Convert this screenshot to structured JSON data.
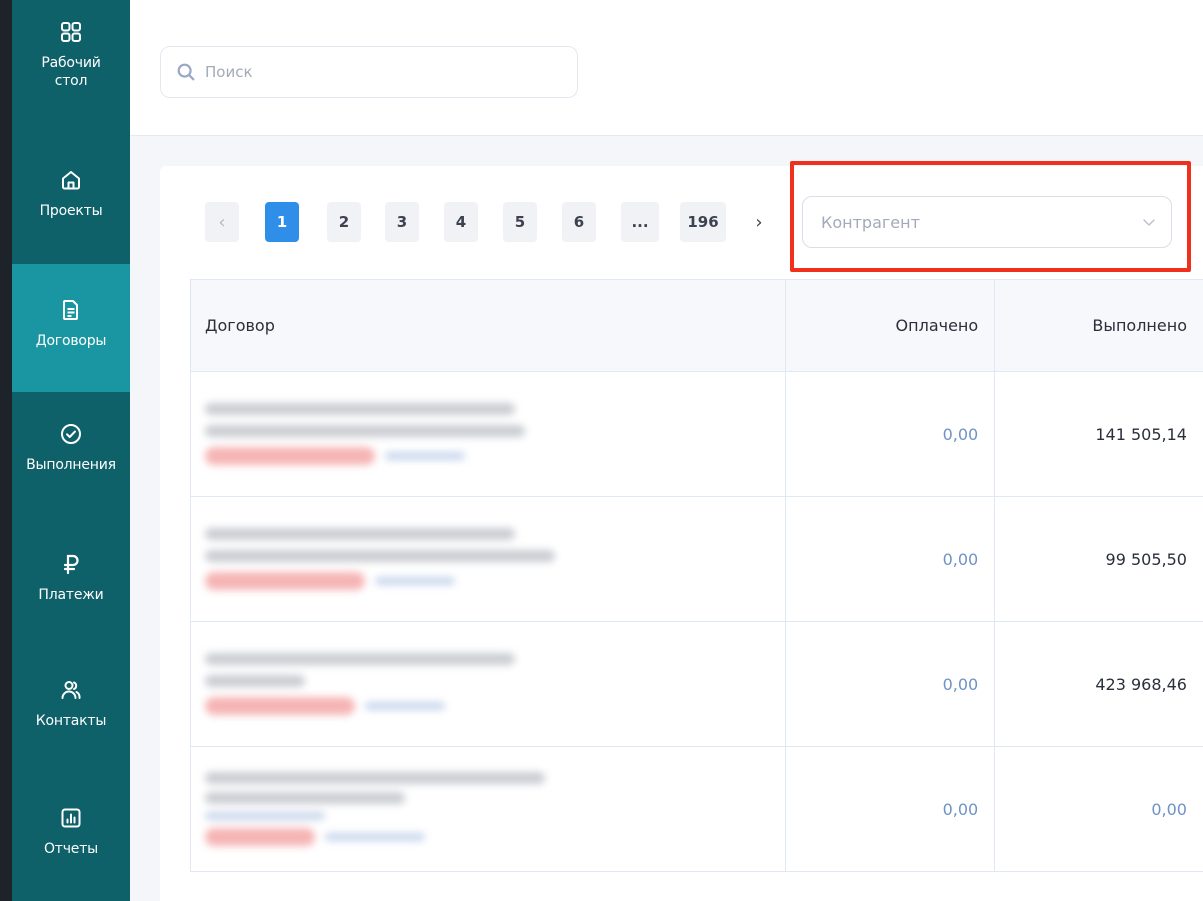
{
  "sidebar": {
    "items": [
      {
        "label": "Рабочий\nстол",
        "icon": "dashboard-grid-icon",
        "active": false
      },
      {
        "label": "Проекты",
        "icon": "home-icon",
        "active": false
      },
      {
        "label": "Договоры",
        "icon": "document-icon",
        "active": true
      },
      {
        "label": "Выполнения",
        "icon": "check-circle-icon",
        "active": false
      },
      {
        "label": "Платежи",
        "icon": "ruble-icon",
        "active": false
      },
      {
        "label": "Контакты",
        "icon": "users-icon",
        "active": false
      },
      {
        "label": "Отчеты",
        "icon": "bar-chart-icon",
        "active": false
      }
    ]
  },
  "search": {
    "placeholder": "Поиск"
  },
  "pagination": {
    "prev": "‹",
    "pages": [
      "1",
      "2",
      "3",
      "4",
      "5",
      "6",
      "...",
      "196"
    ],
    "current": "1",
    "next": "›"
  },
  "filter": {
    "placeholder": "Контрагент"
  },
  "table": {
    "columns": [
      "Договор",
      "Оплачено",
      "Выполнено"
    ],
    "rows": [
      {
        "paid": "0,00",
        "done": "141 505,14"
      },
      {
        "paid": "0,00",
        "done": "99 505,50"
      },
      {
        "paid": "0,00",
        "done": "423 968,46"
      },
      {
        "paid": "0,00",
        "done": "0,00"
      }
    ]
  },
  "colors": {
    "sidebar": "#0e6069",
    "sidebar_active": "#1a96a2",
    "accent": "#2f8fe8",
    "highlight": "#f0301d",
    "muted_value": "#6f93c6"
  }
}
